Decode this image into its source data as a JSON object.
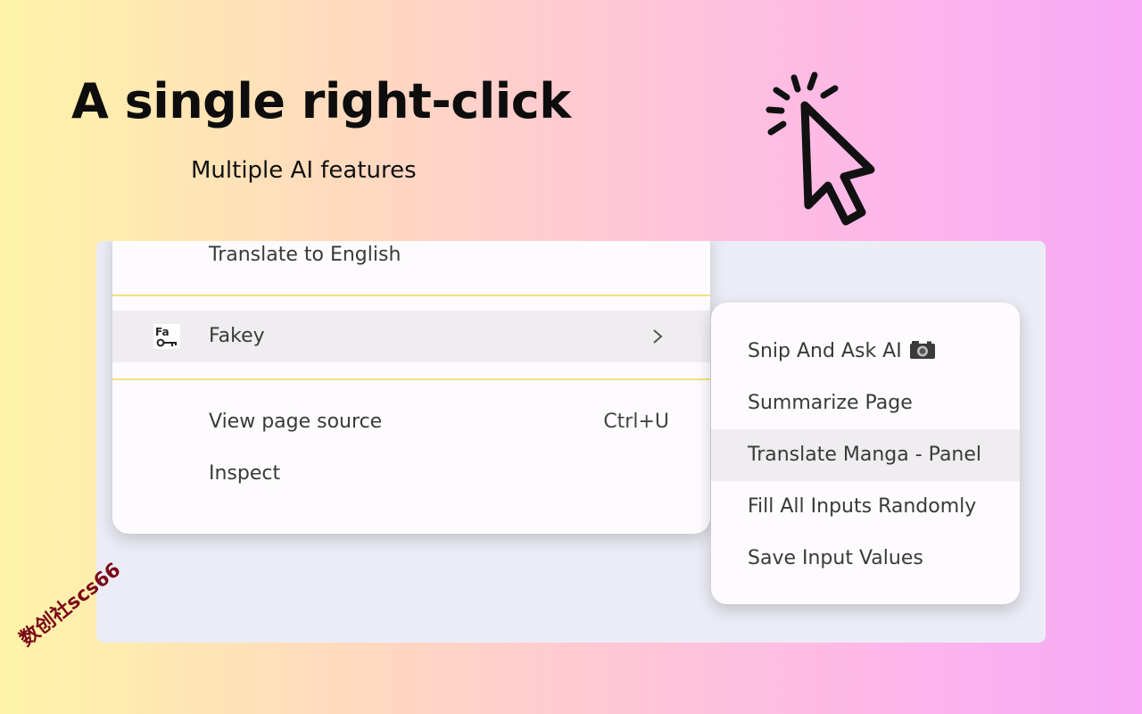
{
  "hero": {
    "title": "A single right-click",
    "subtitle": "Multiple AI features"
  },
  "context_menu": {
    "items": [
      {
        "label": "Translate to English"
      },
      {
        "label": "Fakey",
        "icon": "fakey-app-icon",
        "has_submenu": true,
        "highlighted": true
      },
      {
        "label": "View page source",
        "shortcut": "Ctrl+U"
      },
      {
        "label": "Inspect"
      }
    ]
  },
  "submenu": {
    "items": [
      {
        "label": "Snip And Ask AI",
        "icon": "camera-icon"
      },
      {
        "label": "Summarize Page"
      },
      {
        "label": "Translate Manga - Panel",
        "highlighted": true
      },
      {
        "label": "Fill All Inputs Randomly"
      },
      {
        "label": "Save Input Values"
      }
    ]
  },
  "watermark": {
    "text": "数创社scs66"
  },
  "colors": {
    "separator": "#f1e27a",
    "highlight": "#efedf0",
    "menu_background": "#fdfbfd",
    "screen_background": "#ececf6",
    "watermark": "#7a0a18"
  }
}
